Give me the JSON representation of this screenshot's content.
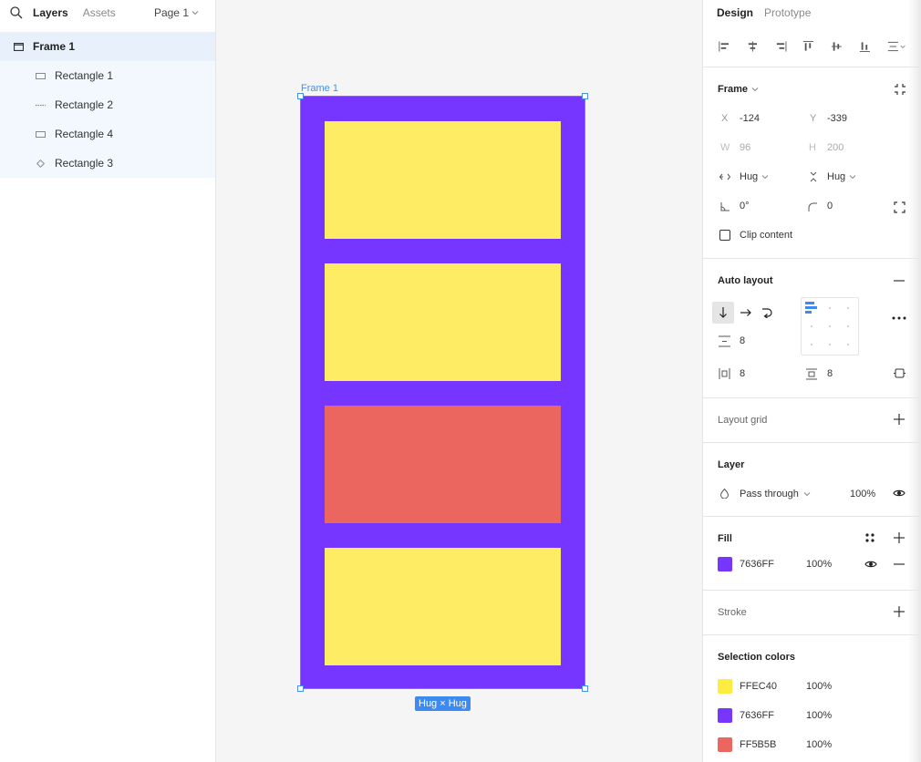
{
  "left_panel": {
    "tabs": {
      "layers": "Layers",
      "assets": "Assets"
    },
    "page_select": "Page 1",
    "layers": [
      {
        "name": "Frame 1",
        "type": "frame"
      },
      {
        "name": "Rectangle 1",
        "type": "rect"
      },
      {
        "name": "Rectangle 2",
        "type": "line"
      },
      {
        "name": "Rectangle 4",
        "type": "rect"
      },
      {
        "name": "Rectangle 3",
        "type": "ellipse"
      }
    ]
  },
  "canvas": {
    "frame_label": "Frame 1",
    "frame_fill": "#7636FF",
    "rect_colors": [
      "#FDEC64",
      "#FDEC64",
      "#EC6660",
      "#FDEC64"
    ],
    "hug_badge": "Hug × Hug"
  },
  "right_panel": {
    "tabs": {
      "design": "Design",
      "prototype": "Prototype"
    },
    "frame": {
      "title": "Frame",
      "x_label": "X",
      "x_value": "-124",
      "y_label": "Y",
      "y_value": "-339",
      "w_label": "W",
      "w_value": "96",
      "h_label": "H",
      "h_value": "200",
      "width_mode": "Hug",
      "height_mode": "Hug",
      "rotation": "0°",
      "radius": "0",
      "clip_content": "Clip content"
    },
    "auto_layout": {
      "title": "Auto layout",
      "spacing": "8",
      "padding_h": "8",
      "padding_v": "8"
    },
    "layout_grid": {
      "title": "Layout grid"
    },
    "layer": {
      "title": "Layer",
      "blend_mode": "Pass through",
      "opacity": "100%"
    },
    "fill": {
      "title": "Fill",
      "hex": "7636FF",
      "color": "#7636FF",
      "opacity": "100%"
    },
    "stroke": {
      "title": "Stroke"
    },
    "selection_colors": {
      "title": "Selection colors",
      "items": [
        {
          "hex": "FFEC40",
          "color": "#FFEC40",
          "opacity": "100%"
        },
        {
          "hex": "7636FF",
          "color": "#7636FF",
          "opacity": "100%"
        },
        {
          "hex": "FF5B5B",
          "color": "#EC6660",
          "opacity": "100%"
        }
      ]
    }
  }
}
